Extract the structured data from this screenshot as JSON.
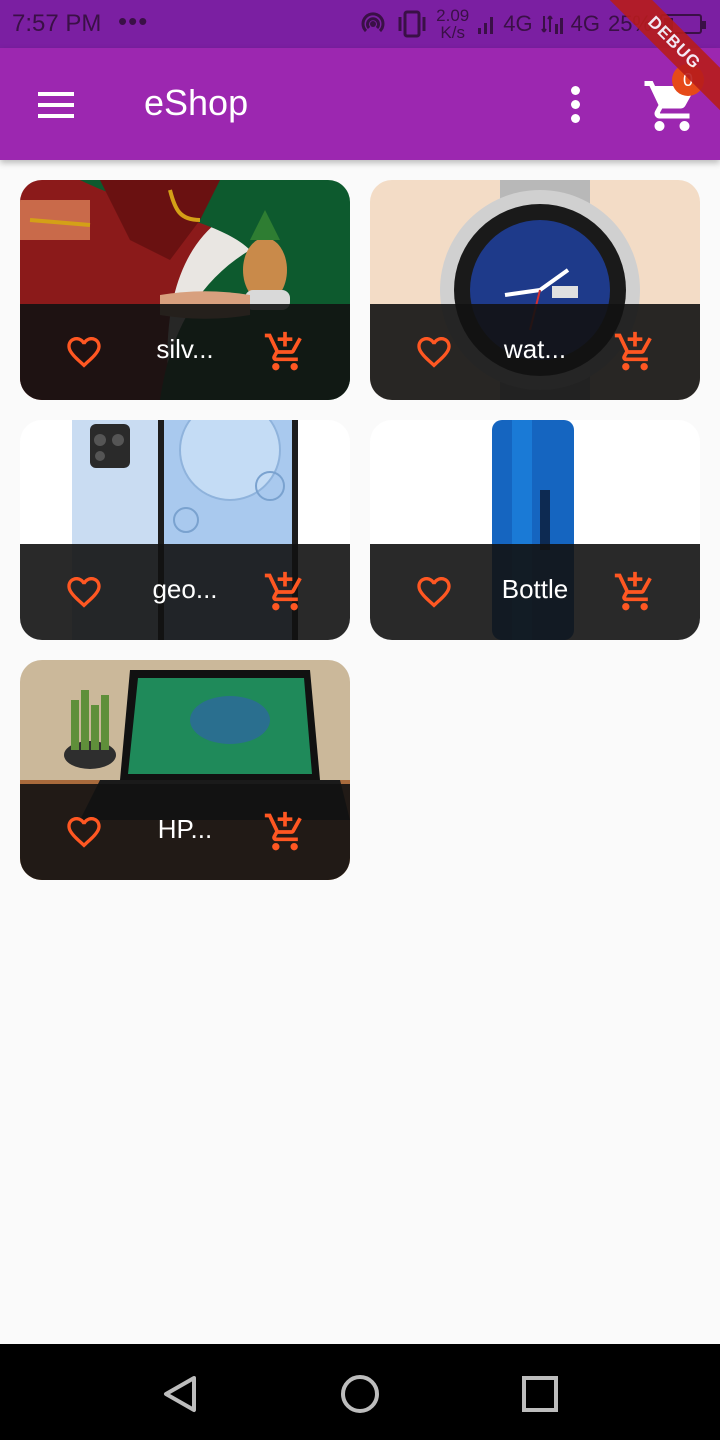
{
  "status_bar": {
    "time": "7:57 PM",
    "dots": "•••",
    "speed_value": "2.09",
    "speed_unit": "K/s",
    "network1": "4G",
    "network2": "4G",
    "battery": "25%",
    "battery_level": 0.25
  },
  "app_bar": {
    "title": "eShop",
    "cart_count": "0",
    "debug_banner": "DEBUG"
  },
  "products": [
    {
      "name": "silv...",
      "image": "saree-kalash-image"
    },
    {
      "name": "wat...",
      "image": "wristwatch-image"
    },
    {
      "name": "geo...",
      "image": "smartphone-image"
    },
    {
      "name": "Bottle",
      "image": "water-bottle-image"
    },
    {
      "name": "HP...",
      "image": "laptop-image"
    }
  ],
  "colors": {
    "status_bar": "#7b1fa2",
    "app_bar": "#9c27b0",
    "accent": "#ff5722",
    "card_footer": "#121212",
    "background": "#fafafa"
  },
  "icons": {
    "menu": "menu-icon",
    "more": "more-vert-icon",
    "cart": "shopping-cart-icon",
    "favorite": "heart-outline-icon",
    "add_to_cart": "add-shopping-cart-icon",
    "nav_back": "triangle-back-icon",
    "nav_home": "circle-home-icon",
    "nav_recents": "square-recents-icon"
  }
}
